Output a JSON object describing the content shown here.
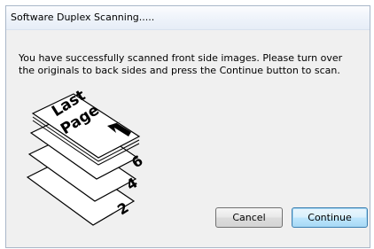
{
  "window": {
    "title": "Software Duplex Scanning....."
  },
  "message": "You have successfully scanned front side images. Please turn over the originals to back sides and press the Continue button to scan.",
  "illustration": {
    "top_page_text_line1": "Last",
    "top_page_text_line2": "Page",
    "page_numbers": [
      "6",
      "4",
      "2"
    ],
    "arrow_icon": "arrow-left-icon"
  },
  "buttons": {
    "cancel_label": "Cancel",
    "continue_label": "Continue"
  },
  "colors": {
    "dialog_background": "#f0f0f0",
    "titlebar_top": "#fbfcfe",
    "default_button_border": "#3c7fb1"
  }
}
